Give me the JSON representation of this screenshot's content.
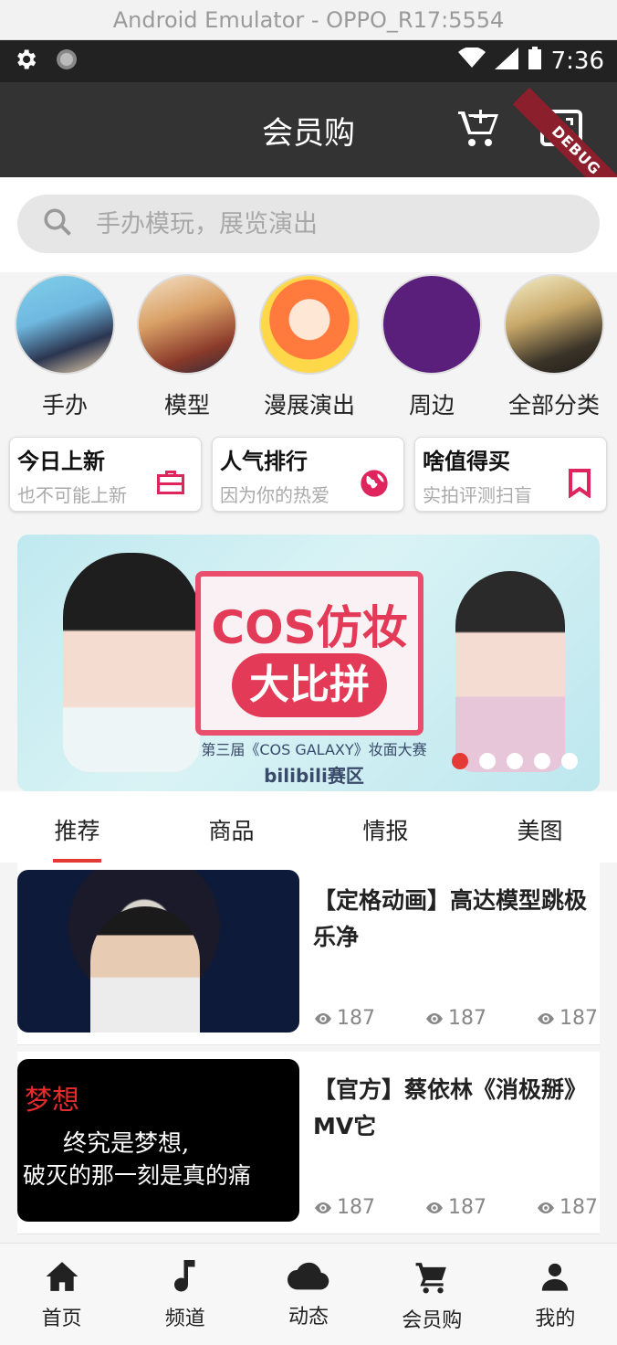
{
  "emulator_title": "Android Emulator - OPPO_R17:5554",
  "status": {
    "time": "7:36",
    "debug": "DEBUG"
  },
  "appbar": {
    "title": "会员购"
  },
  "search": {
    "placeholder": "手办模玩，展览演出"
  },
  "categories": [
    {
      "label": "手办"
    },
    {
      "label": "模型"
    },
    {
      "label": "漫展演出"
    },
    {
      "label": "周边"
    },
    {
      "label": "全部分类"
    }
  ],
  "cards": [
    {
      "title": "今日上新",
      "sub": "也不可能上新",
      "icon": "briefcase-icon"
    },
    {
      "title": "人气排行",
      "sub": "因为你的热爱",
      "icon": "globe-icon"
    },
    {
      "title": "啥值得买",
      "sub": "实拍评测扫盲",
      "icon": "bookmark-icon"
    }
  ],
  "banner": {
    "line1": "COS仿妆",
    "line2": "大比拼",
    "line3": "第三届《COS GALAXY》妆面大赛",
    "line4": "bilibili赛区",
    "dots": 5,
    "active_dot": 0
  },
  "tabs": [
    {
      "label": "推荐"
    },
    {
      "label": "商品"
    },
    {
      "label": "情报"
    },
    {
      "label": "美图"
    }
  ],
  "items": [
    {
      "title": "【定格动画】高达模型跳极乐净",
      "stats": [
        "187",
        "187",
        "187"
      ],
      "overlay_text": ""
    },
    {
      "title": "【官方】蔡依林《消极掰》MV它",
      "stats": [
        "187",
        "187",
        "187"
      ],
      "overlay_line1": "梦想",
      "overlay_line2": "终究是梦想,",
      "overlay_line3": "破灭的那一刻是真的痛"
    }
  ],
  "bottom_nav": [
    {
      "label": "首页",
      "icon": "home-icon"
    },
    {
      "label": "频道",
      "icon": "music-note-icon"
    },
    {
      "label": "动态",
      "icon": "cloud-icon"
    },
    {
      "label": "会员购",
      "icon": "cart-icon"
    },
    {
      "label": "我的",
      "icon": "person-icon"
    }
  ],
  "colors": {
    "accent": "#e53935",
    "card_icon": "#e0245e",
    "appbar": "#333333"
  }
}
